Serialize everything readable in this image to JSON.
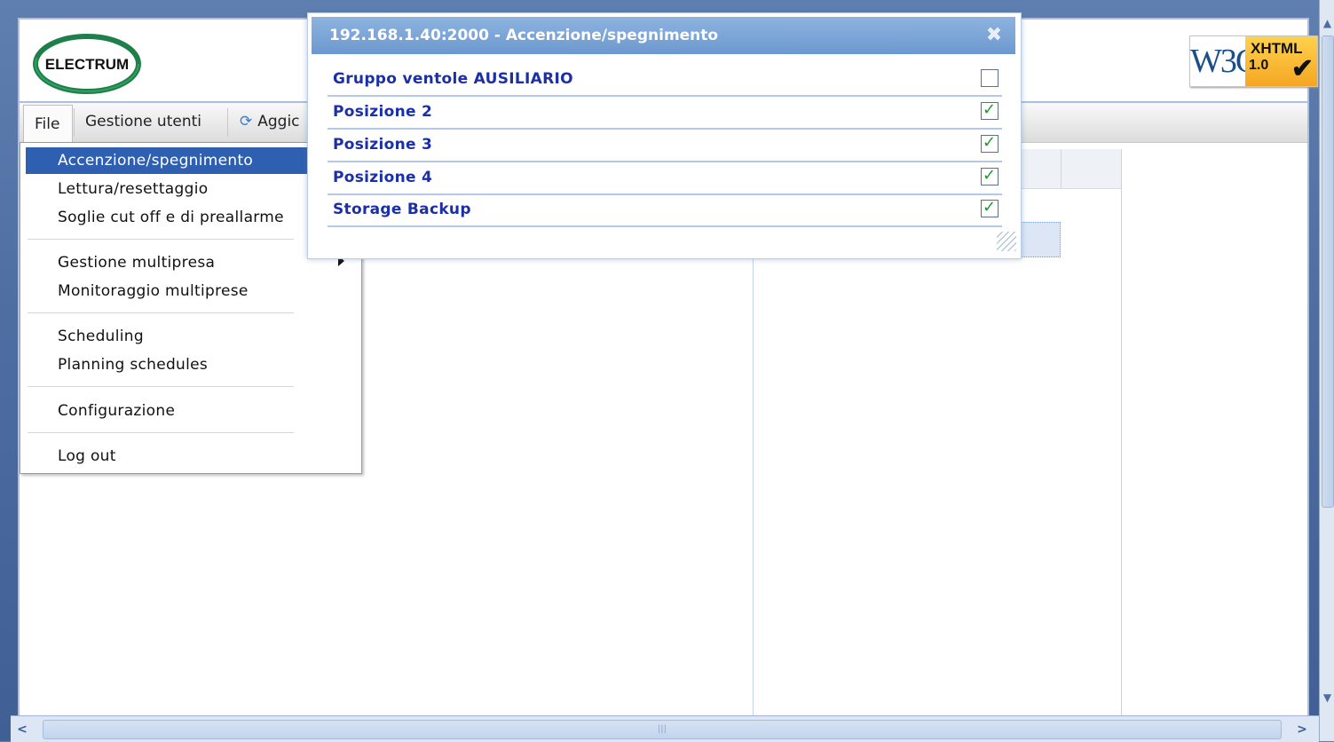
{
  "header": {
    "logo_text": "ELECTRUM",
    "badge_left": "W3C",
    "badge_xhtml": "XHTML",
    "badge_version": "1.0"
  },
  "menubar": {
    "file": "File",
    "users": "Gestione utenti",
    "refresh": "Aggic"
  },
  "dropdown": {
    "items": [
      "Accenzione/spegnimento",
      "Lettura/resettaggio",
      "Soglie cut off e di preallarme",
      "Gestione multipresa",
      "Monitoraggio multiprese",
      "Scheduling",
      "Planning schedules",
      "Configurazione",
      "Log out"
    ],
    "active_index": 0
  },
  "dialog": {
    "title": "192.168.1.40:2000 - Accenzione/spegnimento",
    "rows": [
      {
        "label": "Gruppo ventole AUSILIARIO",
        "checked": false
      },
      {
        "label": "Posizione 2",
        "checked": true
      },
      {
        "label": "Posizione 3",
        "checked": true
      },
      {
        "label": "Posizione 4",
        "checked": true
      },
      {
        "label": "Storage Backup",
        "checked": true
      }
    ]
  },
  "colors": {
    "accent": "#2e5fb0",
    "dialog_label": "#1b2fa8",
    "check": "#1e9a2c"
  }
}
